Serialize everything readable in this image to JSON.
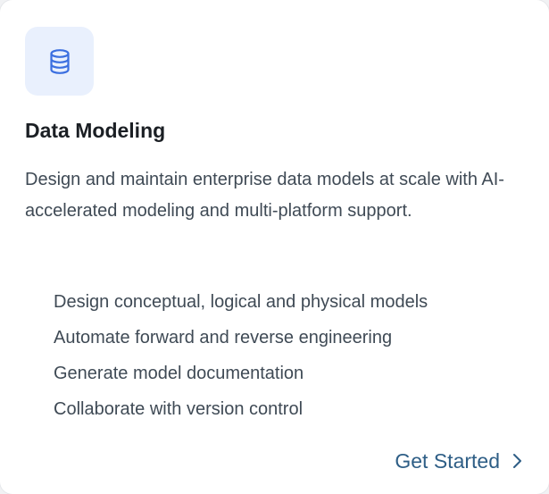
{
  "card": {
    "icon": "database-icon",
    "accent_color": "#3b6fe0",
    "icon_bg_color": "#e9f0fd",
    "title": "Data Modeling",
    "description": "Design and maintain enterprise data models at scale with AI-accelerated modeling and multi-platform support.",
    "features": [
      "Design conceptual, logical and physical models",
      "Automate forward and reverse engineering",
      "Generate model documentation",
      "Collaborate with version control"
    ],
    "cta": {
      "label": "Get Started",
      "icon": "chevron-right-icon",
      "color": "#2e5e86"
    }
  }
}
